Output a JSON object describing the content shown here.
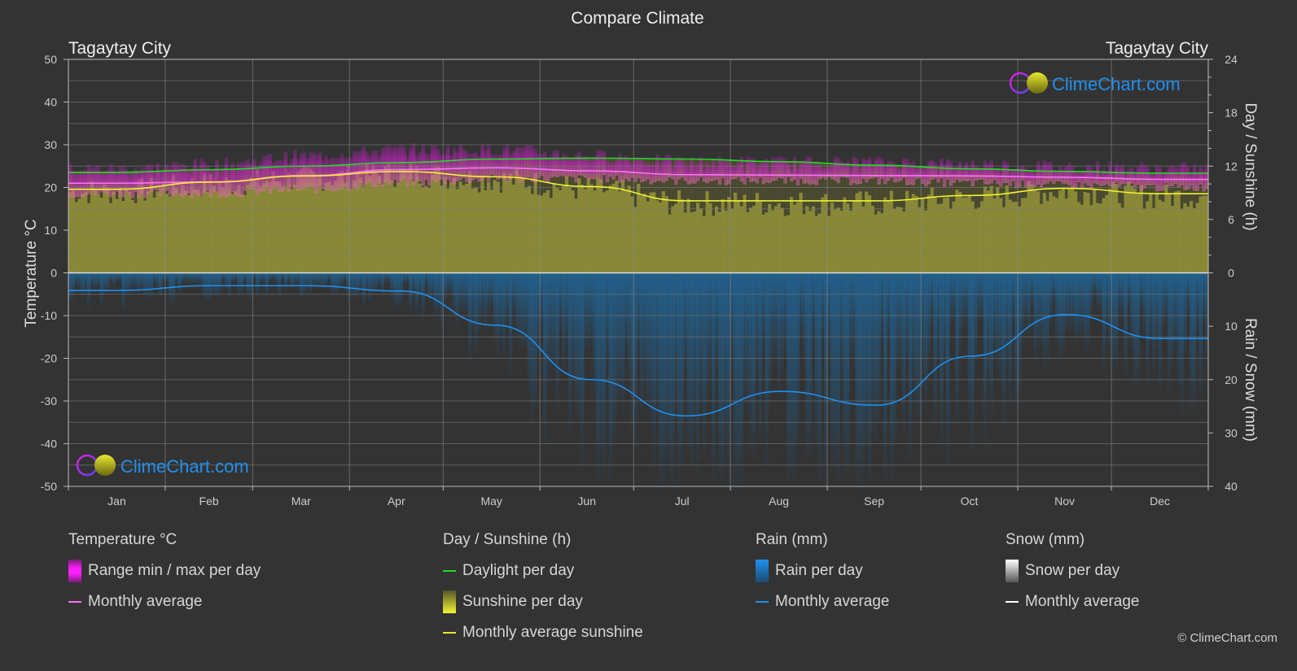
{
  "title": "Compare Climate",
  "location_left": "Tagaytay City",
  "location_right": "Tagaytay City",
  "watermark": "ClimeChart.com",
  "copyright": "© ClimeChart.com",
  "colors": {
    "background": "#333333",
    "temp_range": "#d020d0",
    "temp_avg": "#ff70ff",
    "daylight": "#22dd22",
    "sunshine_fill": "#8c8c38",
    "sunshine_avg": "#f2f230",
    "rain_fill": "#1e5e90",
    "rain_avg": "#1e90f0",
    "snow_avg": "#ffffff",
    "grid": "#6a6a6a",
    "brand_blue": "#1e90f0"
  },
  "chart_data": {
    "type": "line",
    "title": "Compare Climate",
    "categories": [
      "Jan",
      "Feb",
      "Mar",
      "Apr",
      "May",
      "Jun",
      "Jul",
      "Aug",
      "Sep",
      "Oct",
      "Nov",
      "Dec"
    ],
    "left_axis": {
      "label": "Temperature °C",
      "range": [
        -50,
        50
      ],
      "ticks": [
        50,
        40,
        30,
        20,
        10,
        0,
        -10,
        -20,
        -30,
        -40,
        -50
      ]
    },
    "right_axis_top": {
      "label": "Day / Sunshine (h)",
      "range": [
        0,
        24
      ],
      "ticks": [
        24,
        18,
        12,
        6,
        0
      ]
    },
    "right_axis_bottom": {
      "label": "Rain / Snow (mm)",
      "range": [
        0,
        40
      ],
      "ticks": [
        10,
        20,
        30,
        40
      ]
    },
    "grid": true,
    "series": [
      {
        "name": "Temperature monthly average",
        "axis": "temperature",
        "unit": "°C",
        "values": [
          21.0,
          21.3,
          22.8,
          24.2,
          24.6,
          23.9,
          23.0,
          22.9,
          22.8,
          22.7,
          22.4,
          21.9
        ]
      },
      {
        "name": "Temperature range max per day (approx)",
        "axis": "temperature",
        "unit": "°C",
        "values": [
          24.5,
          25.5,
          27.5,
          29.0,
          29.0,
          27.5,
          26.0,
          26.0,
          26.0,
          25.5,
          25.0,
          24.5
        ]
      },
      {
        "name": "Temperature range min per day (approx)",
        "axis": "temperature",
        "unit": "°C",
        "values": [
          18.5,
          18.5,
          19.5,
          21.0,
          22.0,
          22.0,
          21.5,
          21.5,
          21.5,
          21.0,
          20.5,
          20.0
        ]
      },
      {
        "name": "Daylight per day",
        "axis": "hours",
        "unit": "h",
        "values": [
          11.3,
          11.6,
          12.0,
          12.4,
          12.8,
          12.9,
          12.8,
          12.5,
          12.1,
          11.7,
          11.4,
          11.2
        ]
      },
      {
        "name": "Monthly average sunshine",
        "axis": "hours",
        "unit": "h",
        "values": [
          9.4,
          10.2,
          10.9,
          11.4,
          10.8,
          9.7,
          8.1,
          8.1,
          8.1,
          8.7,
          9.5,
          8.9
        ]
      },
      {
        "name": "Rain monthly average",
        "axis": "precip",
        "unit": "mm",
        "values": [
          3.3,
          2.4,
          2.4,
          3.4,
          9.8,
          20.0,
          26.8,
          22.2,
          24.8,
          15.6,
          7.8,
          12.3
        ]
      },
      {
        "name": "Snow monthly average",
        "axis": "precip",
        "unit": "mm",
        "values": [
          0,
          0,
          0,
          0,
          0,
          0,
          0,
          0,
          0,
          0,
          0,
          0
        ]
      }
    ]
  },
  "legend": {
    "temperature": {
      "header": "Temperature °C",
      "items": [
        "Range min / max per day",
        "Monthly average"
      ]
    },
    "sunshine": {
      "header": "Day / Sunshine (h)",
      "items": [
        "Daylight per day",
        "Sunshine per day",
        "Monthly average sunshine"
      ]
    },
    "rain": {
      "header": "Rain (mm)",
      "items": [
        "Rain per day",
        "Monthly average"
      ]
    },
    "snow": {
      "header": "Snow (mm)",
      "items": [
        "Snow per day",
        "Monthly average"
      ]
    }
  }
}
